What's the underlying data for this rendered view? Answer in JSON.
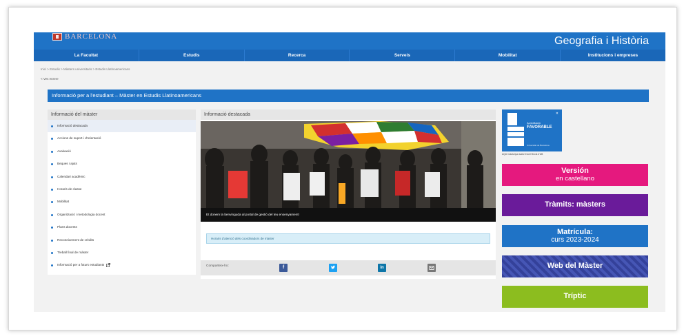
{
  "brand": {
    "name": "BARCELONA",
    "site_title": "Geografia i Història"
  },
  "nav": [
    "La Facultat",
    "Estudis",
    "Recerca",
    "Serveis",
    "Mobilitat",
    "Institucions i empreses"
  ],
  "breadcrumb": "Inici > Estudis > Màsters universitaris > Estudis Llatinoamericans",
  "back_link": "< Ves enrere",
  "banner_title": "Informació per a l'estudiant – Màster en Estudis Llatinoamericans",
  "sidebar": {
    "title": "Informació del màster",
    "items": [
      "Informació destacada",
      "Accions de suport i d'orientació",
      "Avaluació",
      "Beques i ajuts",
      "Calendari acadèmic",
      "Horaris de classe",
      "Mobilitat",
      "Organització i metodologia docent",
      "Plans docents",
      "Reconeixement de crèdits",
      "Treball final de màster",
      "Informació per a futurs estudiants"
    ],
    "external_icon": "external-link-icon"
  },
  "main": {
    "title": "Informació destacada",
    "caption": "Et donem la benvinguda al portal de gestió del teu ensenyament!",
    "info_link": "Horaris d'atenció dels coordinadors de màster",
    "share_label": "Comparteix-ho:",
    "share_icons": [
      "facebook-icon",
      "twitter-icon",
      "linkedin-icon",
      "email-icon"
    ]
  },
  "aqu": {
    "line1": "Acreditació",
    "line2": "FAVORABLE",
    "small": "Universitat de Barcelona",
    "note": "AQU Catalunya avala l'excel·lència d'UB"
  },
  "buttons": {
    "version": [
      "Versión",
      "en castellano"
    ],
    "tramits": "Tràmits: màsters",
    "matricula": [
      "Matrícula:",
      "curs 2023-2024"
    ],
    "web": "Web del Màster",
    "triptic": "Tríptic"
  },
  "colors": {
    "primary": "#1f73c6",
    "magenta": "#e5197e",
    "purple": "#6a1b9a",
    "green": "#8cbd1f"
  }
}
